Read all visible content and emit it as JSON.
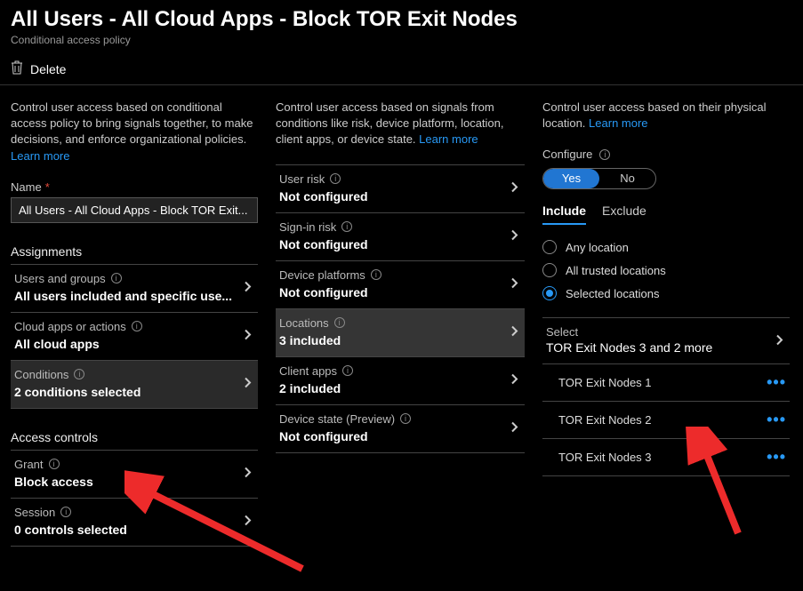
{
  "header": {
    "title": "All Users - All Cloud Apps - Block TOR Exit Nodes",
    "subtitle": "Conditional access policy"
  },
  "toolbar": {
    "delete_label": "Delete"
  },
  "col1": {
    "intro_text": "Control user access based on conditional access policy to bring signals together, to make decisions, and enforce organizational policies. ",
    "learn_more": "Learn more",
    "name_label": "Name",
    "name_value": "All Users - All Cloud Apps - Block TOR Exit...",
    "assignments_header": "Assignments",
    "users_groups_label": "Users and groups",
    "users_groups_value": "All users included and specific use...",
    "cloud_apps_label": "Cloud apps or actions",
    "cloud_apps_value": "All cloud apps",
    "conditions_label": "Conditions",
    "conditions_value": "2 conditions selected",
    "access_controls_header": "Access controls",
    "grant_label": "Grant",
    "grant_value": "Block access",
    "session_label": "Session",
    "session_value": "0 controls selected"
  },
  "col2": {
    "intro_text": "Control user access based on signals from conditions like risk, device platform, location, client apps, or device state. ",
    "learn_more": "Learn more",
    "user_risk_label": "User risk",
    "user_risk_value": "Not configured",
    "signin_risk_label": "Sign-in risk",
    "signin_risk_value": "Not configured",
    "device_platforms_label": "Device platforms",
    "device_platforms_value": "Not configured",
    "locations_label": "Locations",
    "locations_value": "3 included",
    "client_apps_label": "Client apps",
    "client_apps_value": "2 included",
    "device_state_label": "Device state (Preview)",
    "device_state_value": "Not configured"
  },
  "col3": {
    "intro_text": "Control user access based on their physical location. ",
    "learn_more": "Learn more",
    "configure_label": "Configure",
    "toggle_yes": "Yes",
    "toggle_no": "No",
    "tab_include": "Include",
    "tab_exclude": "Exclude",
    "radio_any": "Any location",
    "radio_trusted": "All trusted locations",
    "radio_selected": "Selected locations",
    "select_label": "Select",
    "select_value": "TOR Exit Nodes 3 and 2 more",
    "locations": [
      "TOR Exit Nodes 1",
      "TOR Exit Nodes 2",
      "TOR Exit Nodes 3"
    ]
  }
}
